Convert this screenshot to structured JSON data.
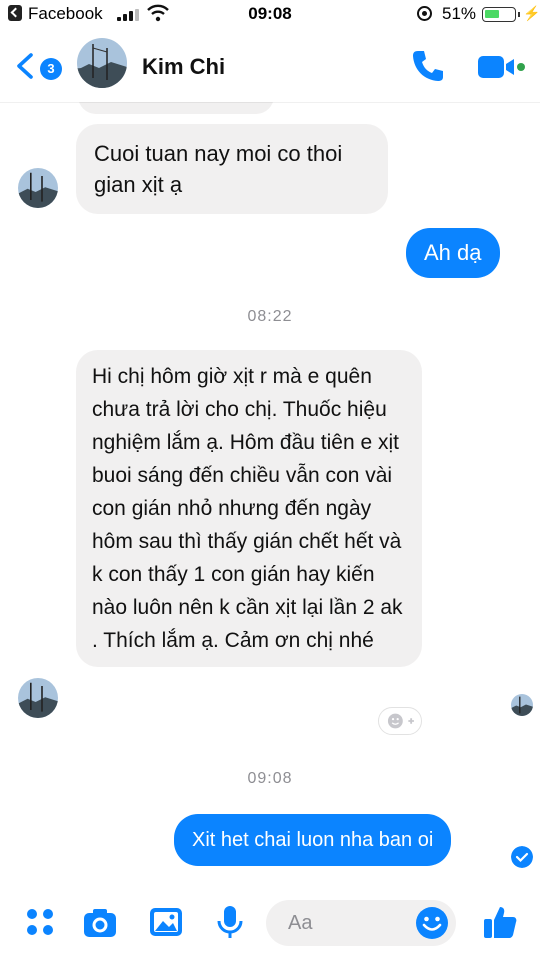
{
  "status_bar": {
    "back_app": "Facebook",
    "time": "09:08",
    "battery": "51%",
    "battery_level": 0.51
  },
  "header": {
    "unread_count": "3",
    "contact_name": "Kim Chi"
  },
  "messages": [
    {
      "from": "contact",
      "text": "Cuoi tuan nay moi co thoi gian xịt ạ"
    },
    {
      "from": "me",
      "text": "Ah dạ"
    },
    {
      "type": "timestamp",
      "text": "08:22"
    },
    {
      "from": "contact",
      "text": "Hi chị hôm giờ xịt r mà e quên chưa trả lời cho chị. Thuốc hiệu nghiệm lắm ạ. Hôm đầu tiên e xịt buoi sáng đến chiều vẫn con vài con gián nhỏ nhưng đến ngày hôm sau thì thấy gián chết hết và k con thấy 1 con gián hay kiến nào luôn nên k cần xịt lại lần 2 ak . Thích lắm ạ. Cảm ơn chị nhé"
    },
    {
      "type": "timestamp",
      "text": "09:08"
    },
    {
      "from": "me",
      "text": "Xit het chai luon nha ban oi"
    }
  ],
  "composer": {
    "placeholder": "Aa"
  },
  "colors": {
    "accent": "#0b84ff",
    "incoming_bubble": "#f1f0f0",
    "online": "#31a24c"
  },
  "icons": [
    "back-chevron-icon",
    "phone-icon",
    "video-call-icon",
    "menu-dots-icon",
    "camera-icon",
    "gallery-icon",
    "microphone-icon",
    "emoji-icon",
    "like-icon",
    "add-reaction-icon",
    "seen-check-icon"
  ]
}
